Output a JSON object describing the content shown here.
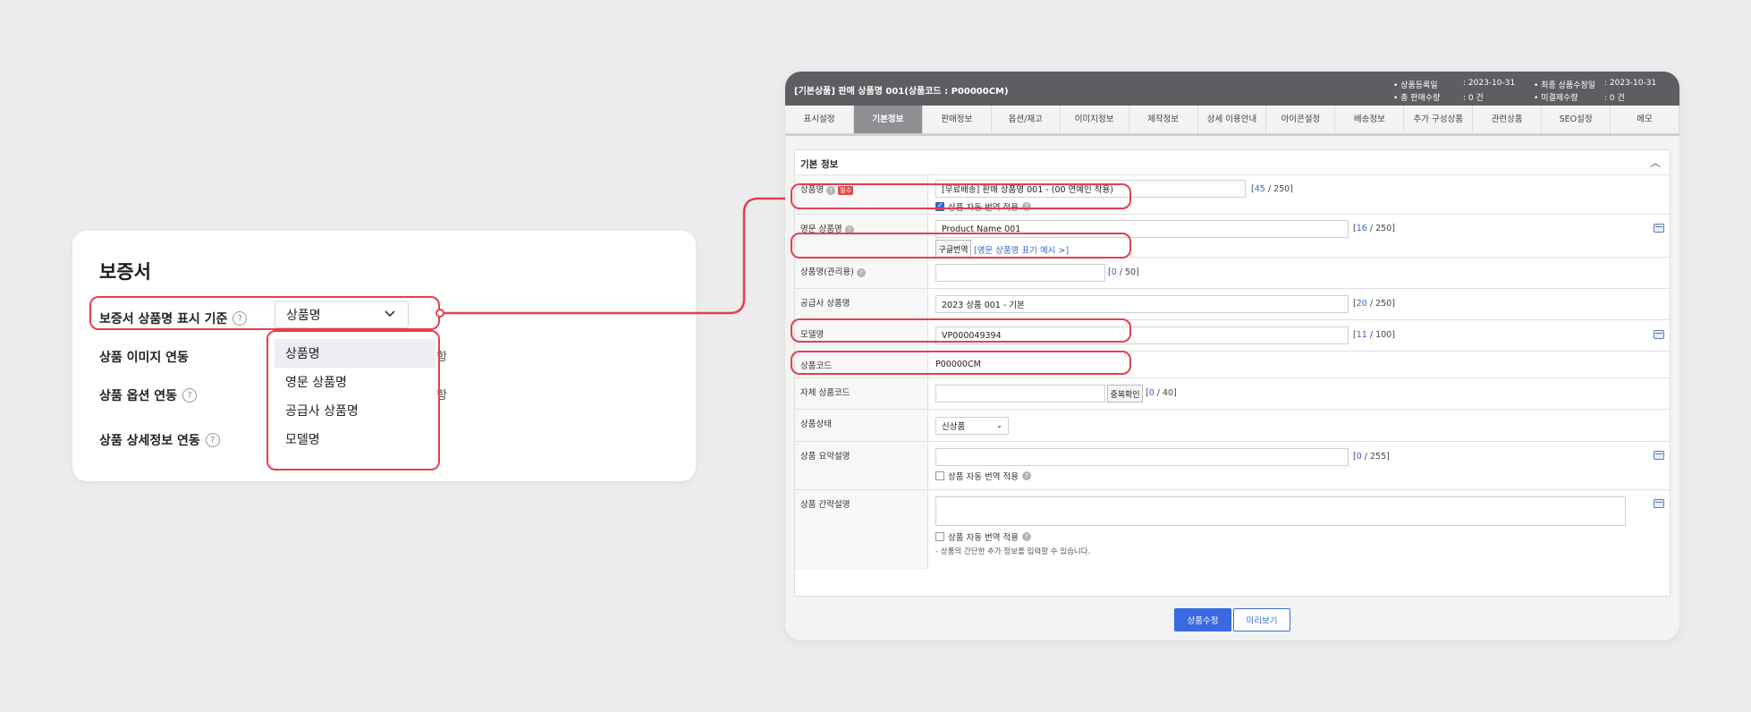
{
  "left_panel": {
    "title": "보증서",
    "rows": [
      {
        "label": "보증서 상품명 표시 기준"
      },
      {
        "label": "상품 이미지 연동"
      },
      {
        "label": "상품 옵션 연동"
      },
      {
        "label": "상품 상세정보 연동"
      }
    ],
    "select_value": "상품명",
    "dropdown_options": [
      "상품명",
      "영문 상품명",
      "공급사 상품명",
      "모델명"
    ],
    "trailing_char": "항"
  },
  "window": {
    "header_title": "[기본상품] 판매 상품명 001(상품코드 : P00000CM)",
    "meta": {
      "reg_label": "• 상품등록일",
      "reg_value": ": 2023-10-31",
      "mod_label": "• 최종 상품수정일",
      "mod_value": ": 2023-10-31",
      "sales_label": "• 총 판매수량",
      "sales_value": ": 0 건",
      "unpaid_label": "• 미결제수량",
      "unpaid_value": ": 0 건"
    },
    "tabs": [
      "표시설정",
      "기본정보",
      "판매정보",
      "옵션/재고",
      "이미지정보",
      "제작정보",
      "상세 이용안내",
      "아이콘설정",
      "배송정보",
      "추가 구성상품",
      "관련상품",
      "SEO설정",
      "메모"
    ],
    "active_tab": 1,
    "section_title": "기본 정보",
    "required_badge": "필수",
    "fields": {
      "product_name": {
        "label": "상품명",
        "value": "[무료배송] 판매 상품명 001 - (00 연예인 착용)",
        "count": "45",
        "max": "250",
        "auto_translate": "상품 자동 번역 적용"
      },
      "english_name": {
        "label": "영문 상품명",
        "value": "Product Name 001",
        "count": "16",
        "max": "250",
        "translate_btn": "구글번역",
        "example_link": "[영문 상품명 표기 예시 >]"
      },
      "admin_name": {
        "label": "상품명(관리용)",
        "value": "",
        "count": "0",
        "max": "50"
      },
      "supplier_name": {
        "label": "공급사 상품명",
        "value": "2023 상품 001 - 기본",
        "count": "20",
        "max": "250"
      },
      "model_name": {
        "label": "모델명",
        "value": "VP000049394",
        "count": "11",
        "max": "100"
      },
      "product_code": {
        "label": "상품코드",
        "value": "P00000CM"
      },
      "own_code": {
        "label": "자체 상품코드",
        "value": "",
        "dup_btn": "중복확인",
        "count": "0",
        "max": "40"
      },
      "status": {
        "label": "상품상태",
        "value": "신상품"
      },
      "summary": {
        "label": "상품 요약설명",
        "value": "",
        "count": "0",
        "max": "255",
        "auto_translate": "상품 자동 번역 적용"
      },
      "brief": {
        "label": "상품 간략설명",
        "auto_translate": "상품 자동 번역 적용",
        "hint": "- 상품의 간단한 추가 정보를 입력할 수 있습니다."
      }
    },
    "buttons": {
      "save": "상품수정",
      "preview": "미리보기"
    }
  },
  "colors": {
    "highlight": "#e43f4f",
    "primary": "#3a6ae0",
    "header": "#5d5d62"
  }
}
